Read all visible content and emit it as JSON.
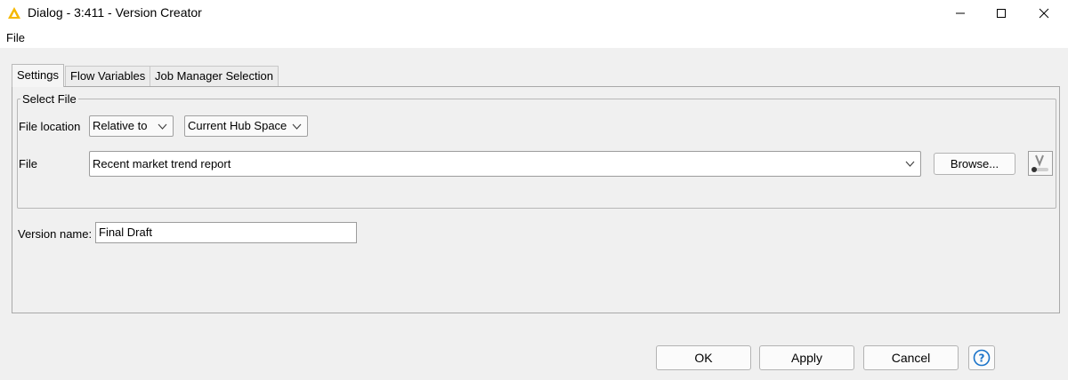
{
  "window": {
    "title": "Dialog - 3:411 - Version Creator",
    "app_icon": "triangle-warning-icon",
    "controls": [
      "minimize-icon",
      "maximize-icon",
      "close-icon"
    ]
  },
  "menu": {
    "file": "File"
  },
  "tabs": [
    {
      "label": "Settings",
      "active": true
    },
    {
      "label": "Flow Variables",
      "active": false
    },
    {
      "label": "Job Manager Selection",
      "active": false
    }
  ],
  "select_file": {
    "title": "Select File",
    "file_location_label": "File location",
    "location_mode": "Relative to",
    "location_target": "Current Hub Space",
    "file_label": "File",
    "file_value": "Recent market trend report",
    "browse_label": "Browse..."
  },
  "version": {
    "label": "Version name:",
    "value": "Final Draft"
  },
  "buttons": {
    "ok": "OK",
    "apply": "Apply",
    "cancel": "Cancel"
  },
  "colors": {
    "app_icon": "#f5b800",
    "help_icon": "#1a73c9"
  }
}
